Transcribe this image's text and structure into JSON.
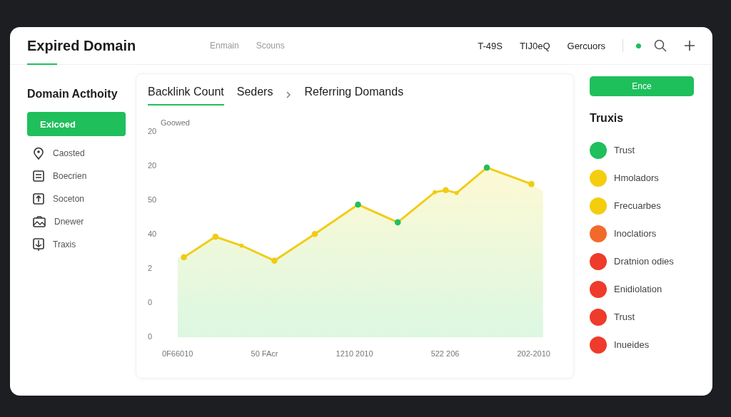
{
  "header": {
    "title": "Expired Domain",
    "nav": [
      "Enmain",
      "Scouns"
    ],
    "links": [
      "T-49S",
      "TIJ0eQ",
      "Gercuors"
    ]
  },
  "sidebar": {
    "title": "Domain Acthoity",
    "items": [
      {
        "label": "Exicoed",
        "selected": true
      },
      {
        "label": "Caosted",
        "selected": false
      },
      {
        "label": "Boecrien",
        "selected": false
      },
      {
        "label": "Soceton",
        "selected": false
      },
      {
        "label": "Dnewer",
        "selected": false
      },
      {
        "label": "Traxis",
        "selected": false
      }
    ]
  },
  "tabs": [
    {
      "label": "Backlink Count",
      "selected": true
    },
    {
      "label": "Seders",
      "selected": false
    },
    {
      "label": "Referring Domands",
      "selected": false
    }
  ],
  "chart": {
    "legend": "Goowed",
    "y_labels": [
      "20",
      "20",
      "50",
      "40",
      "2",
      "0",
      "0"
    ],
    "x_labels": [
      "0F66010",
      "50 FAcr",
      "1210 2010",
      "522 206",
      "202-2010"
    ]
  },
  "right": {
    "button": "Ence",
    "title": "Truxis",
    "items": [
      {
        "label": "Trust",
        "color": "#1fbf5c"
      },
      {
        "label": "Hmoladors",
        "color": "#f5cd0f"
      },
      {
        "label": "Frecuarbes",
        "color": "#f5cd0f"
      },
      {
        "label": "Inoclatiors",
        "color": "#f26a2a"
      },
      {
        "label": "Dratnion odies",
        "color": "#ee3b2b"
      },
      {
        "label": "Enidiolation",
        "color": "#ee3b2b"
      },
      {
        "label": "Trust",
        "color": "#ee3b2b"
      },
      {
        "label": "Inueides",
        "color": "#ee3b2b"
      }
    ]
  }
}
